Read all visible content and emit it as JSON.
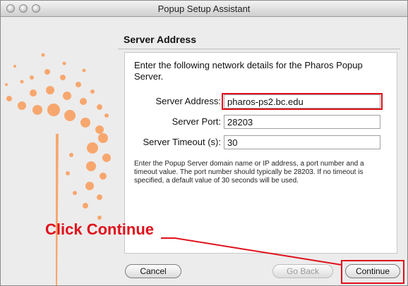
{
  "window": {
    "title": "Popup Setup Assistant"
  },
  "page": {
    "heading": "Server Address",
    "intro": "Enter the following network details for the Pharos Popup Server."
  },
  "form": {
    "server_address_label": "Server Address:",
    "server_address_value": "pharos-ps2.bc.edu",
    "server_port_label": "Server Port:",
    "server_port_value": "28203",
    "server_timeout_label": "Server Timeout (s):",
    "server_timeout_value": "30"
  },
  "note": "Enter the Popup Server domain name or IP address, a port number and a timeout value. The port number should typically be 28203. If no timeout is specified, a default value of 30 seconds will be used.",
  "buttons": {
    "cancel": "Cancel",
    "go_back": "Go Back",
    "continue": "Continue"
  },
  "annotation": {
    "callout": "Click Continue"
  },
  "colors": {
    "highlight": "#e0101a",
    "art": "#f7a76e"
  }
}
